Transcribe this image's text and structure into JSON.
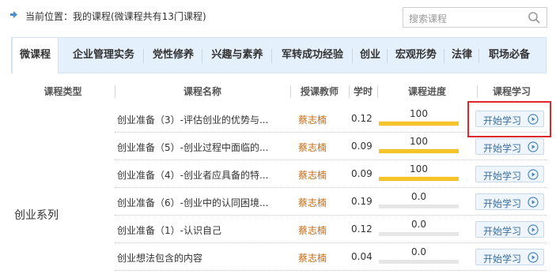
{
  "location": {
    "text": "当前位置：我的课程(微课程共有13门课程)"
  },
  "search": {
    "placeholder": "搜索课程"
  },
  "tabs": [
    {
      "label": "微课程",
      "active": true
    },
    {
      "label": "企业管理实务",
      "active": false
    },
    {
      "label": "党性修养",
      "active": false
    },
    {
      "label": "兴趣与素养",
      "active": false
    },
    {
      "label": "军转成功经验",
      "active": false
    },
    {
      "label": "创业",
      "active": false
    },
    {
      "label": "宏观形势",
      "active": false
    },
    {
      "label": "法律",
      "active": false
    },
    {
      "label": "职场必备",
      "active": false
    }
  ],
  "table": {
    "headers": [
      "课程类型",
      "课程名称",
      "授课教师",
      "学时",
      "课程进度",
      "课程学习"
    ],
    "category": "创业系列",
    "rows": [
      {
        "name": "创业准备（3）-评估创业的优势与...",
        "teacher": "蔡志楠",
        "hours": "0.12",
        "progress_label": "100",
        "progress": 1.0,
        "action": "开始学习"
      },
      {
        "name": "创业准备（5）-创业过程中面临的...",
        "teacher": "蔡志楠",
        "hours": "0.09",
        "progress_label": "100",
        "progress": 1.0,
        "action": "开始学习"
      },
      {
        "name": "创业准备（4）-创业者应具备的特...",
        "teacher": "蔡志楠",
        "hours": "0.09",
        "progress_label": "100",
        "progress": 1.0,
        "action": "开始学习"
      },
      {
        "name": "创业准备（6）-创业中的认同困境...",
        "teacher": "蔡志楠",
        "hours": "0.19",
        "progress_label": "0.0",
        "progress": 0.0,
        "action": "开始学习"
      },
      {
        "name": "创业准备（1）-认识自己",
        "teacher": "蔡志楠",
        "hours": "0.12",
        "progress_label": "0.0",
        "progress": 0.0,
        "action": "开始学习"
      },
      {
        "name": "创业想法包含的内容",
        "teacher": "蔡志楠",
        "hours": "0.04",
        "progress_label": "0.0",
        "progress": 0.0,
        "action": "开始学习"
      }
    ]
  },
  "colors": {
    "tab_bar_bg": "#e4f0fb",
    "teacher_text": "#c26a15",
    "progress_fill": "#f0b400",
    "button_text": "#3c6f9e",
    "highlight": "#e0282c"
  },
  "icons": {
    "location": "blue-arrow-icon",
    "search": "search-icon",
    "button": "play-circle-icon"
  }
}
